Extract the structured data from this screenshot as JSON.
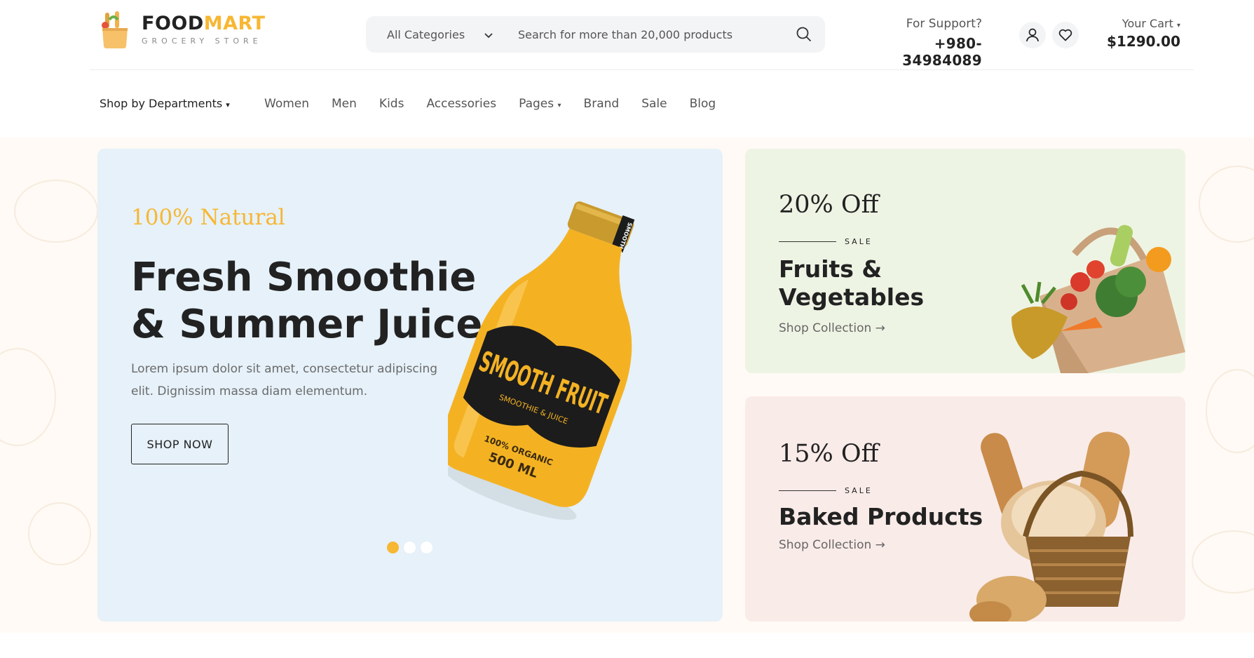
{
  "header": {
    "logo": {
      "title_part1": "FOOD",
      "title_part2": "MART",
      "subtitle": "GROCERY STORE"
    },
    "search": {
      "category_value": "All Categories",
      "placeholder": "Search for more than 20,000 products"
    },
    "support": {
      "label": "For Support?",
      "phone": "+980-34984089"
    },
    "cart": {
      "label": "Your Cart",
      "amount": "$1290.00"
    }
  },
  "nav": {
    "departments": "Shop by Departments",
    "links": [
      "Women",
      "Men",
      "Kids",
      "Accessories",
      "Pages",
      "Brand",
      "Sale",
      "Blog"
    ]
  },
  "hero": {
    "eyebrow": "100% Natural",
    "title": "Fresh Smoothie & Summer Juice",
    "description": "Lorem ipsum dolor sit amet, consectetur adipiscing elit. Dignissim massa diam elementum.",
    "cta": "SHOP NOW",
    "bottle_label_top": "SMOOTH F",
    "bottle_label_main": "SMOOTH FRUIT",
    "bottle_label_sub": "SMOOTHIE & JUICE",
    "bottle_label_organic": "100% ORGANIC",
    "bottle_label_volume": "500 ML",
    "slides": 3,
    "active_slide": 1
  },
  "promos": [
    {
      "discount": "20% Off",
      "tag": "SALE",
      "title": "Fruits & Vegetables",
      "link": "Shop Collection →"
    },
    {
      "discount": "15% Off",
      "tag": "SALE",
      "title": "Baked Products",
      "link": "Shop Collection →"
    }
  ],
  "colors": {
    "accent": "#f7b733",
    "hero_bg": "#e6f1f9",
    "promo1_bg": "#eef4e4",
    "promo2_bg": "#f9ebe8"
  },
  "icons": [
    "search-icon",
    "chevron-down-icon",
    "user-icon",
    "heart-icon",
    "caret-down-icon",
    "arrow-right-icon"
  ]
}
